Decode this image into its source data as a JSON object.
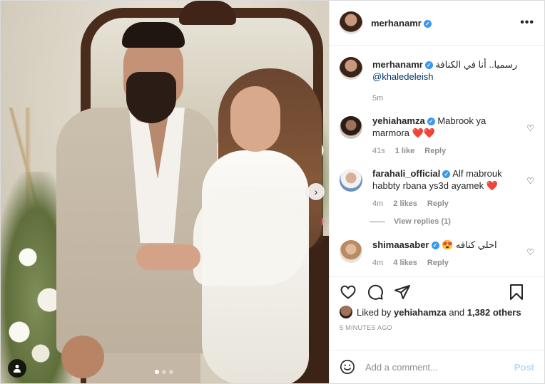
{
  "post": {
    "username": "merhanamr",
    "carousel": {
      "slide_count": 3,
      "active_index": 0
    }
  },
  "caption": {
    "username": "merhanamr",
    "text": "رسميا.. أنا في الكنافة",
    "mention": "@khaledeleish",
    "time": "5m"
  },
  "comments": [
    {
      "username": "yehiahamza",
      "text": "Mabrook ya marmora ❤️❤️",
      "time": "41s",
      "likes": "1 like",
      "reply": "Reply"
    },
    {
      "username": "farahali_official",
      "text": "Alf mabrouk habbty rbana ys3d ayamek ❤️",
      "time": "4m",
      "likes": "2 likes",
      "reply": "Reply"
    },
    {
      "username": "shimaasaber",
      "text": "احلي كنافه 😍",
      "time": "4m",
      "likes": "4 likes",
      "reply": "Reply"
    }
  ],
  "view_replies": "View replies (1)",
  "likes": {
    "prefix": "Liked by",
    "user": "yehiahamza",
    "and": "and",
    "others": "1,382 others"
  },
  "posted_time": "5 minutes ago",
  "add_comment": {
    "placeholder": "Add a comment...",
    "post_label": "Post"
  },
  "colors": {
    "link": "#00376b",
    "verified": "#3897f0",
    "post_disabled": "#b3dbff",
    "muted": "#8e8e8e"
  },
  "icons": [
    "heart-icon",
    "comment-icon",
    "share-icon",
    "bookmark-icon",
    "emoji-icon",
    "more-icon",
    "verified-icon",
    "chevron-right-icon",
    "user-tag-icon"
  ]
}
